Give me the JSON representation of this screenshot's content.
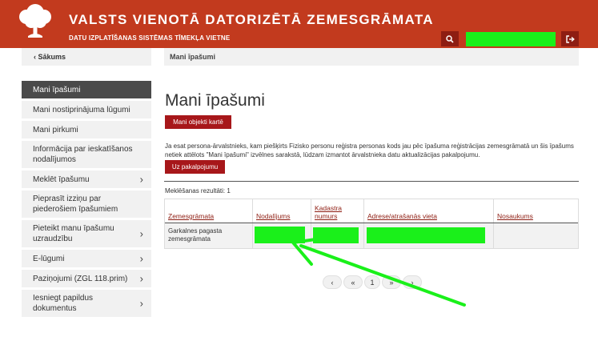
{
  "header": {
    "title": "VALSTS VIENOTĀ DATORIZĒTĀ ZEMESGRĀMATA",
    "subtitle": "DATU IZPLATĪŠANAS SISTĒMAS TĪMEKĻA VIETNE",
    "search_icon": "search-icon",
    "logout_icon": "logout-icon",
    "accent": "#c23a1e"
  },
  "nav": {
    "back_label": "Sākums",
    "breadcrumb": "Mani īpašumi"
  },
  "sidebar": {
    "items": [
      {
        "label": "Mani īpašumi",
        "active": true,
        "chevron": false
      },
      {
        "label": "Mani nostiprinājuma lūgumi",
        "active": false,
        "chevron": false
      },
      {
        "label": "Mani pirkumi",
        "active": false,
        "chevron": false
      },
      {
        "label": "Informācija par ieskatīšanos nodalījumos",
        "active": false,
        "chevron": false
      },
      {
        "label": "Meklēt īpašumu",
        "active": false,
        "chevron": true
      },
      {
        "label": "Pieprasīt izziņu par piederošiem īpašumiem",
        "active": false,
        "chevron": false
      },
      {
        "label": "Pieteikt manu īpašumu uzraudzību",
        "active": false,
        "chevron": true
      },
      {
        "label": "E-lūgumi",
        "active": false,
        "chevron": true
      },
      {
        "label": "Paziņojumi (ZGL 118.prim)",
        "active": false,
        "chevron": true
      },
      {
        "label": "Iesniegt papildus dokumentus",
        "active": false,
        "chevron": true
      }
    ]
  },
  "main": {
    "title": "Mani īpašumi",
    "map_button": "Mani objekti kartē",
    "info": "Ja esat persona-ārvalstnieks, kam piešķirts Fizisko personu reģistra personas kods jau pēc īpašuma reģistrācijas zemesgrāmatā un šis īpašums netiek attēlots \"Mani īpašumi\" izvēlnes sarakstā, lūdzam izmantot ārvalstnieka datu aktualizācijas pakalpojumu.",
    "service_button": "Uz pakalpojumu",
    "results": "Meklēšanas rezultāti: 1",
    "table": {
      "columns": [
        "Zemesgrāmata",
        "Nodalījums",
        "Kadastra numurs",
        "Adrese/atrašanās vieta",
        "Nosaukums"
      ],
      "rows": [
        {
          "zemesgramata": "Garkalnes pagasta zemesgrāmata",
          "nodalijums": "",
          "kadastra": "",
          "adrese": "",
          "nosaukums": ""
        }
      ]
    }
  },
  "pagination": {
    "prev_icon": "chevron-left-icon",
    "first_icon": "double-chevron-left-icon",
    "page": "1",
    "last_icon": "double-chevron-right-icon",
    "next_icon": "chevron-right-icon"
  },
  "highlight_color": "#1af01a"
}
